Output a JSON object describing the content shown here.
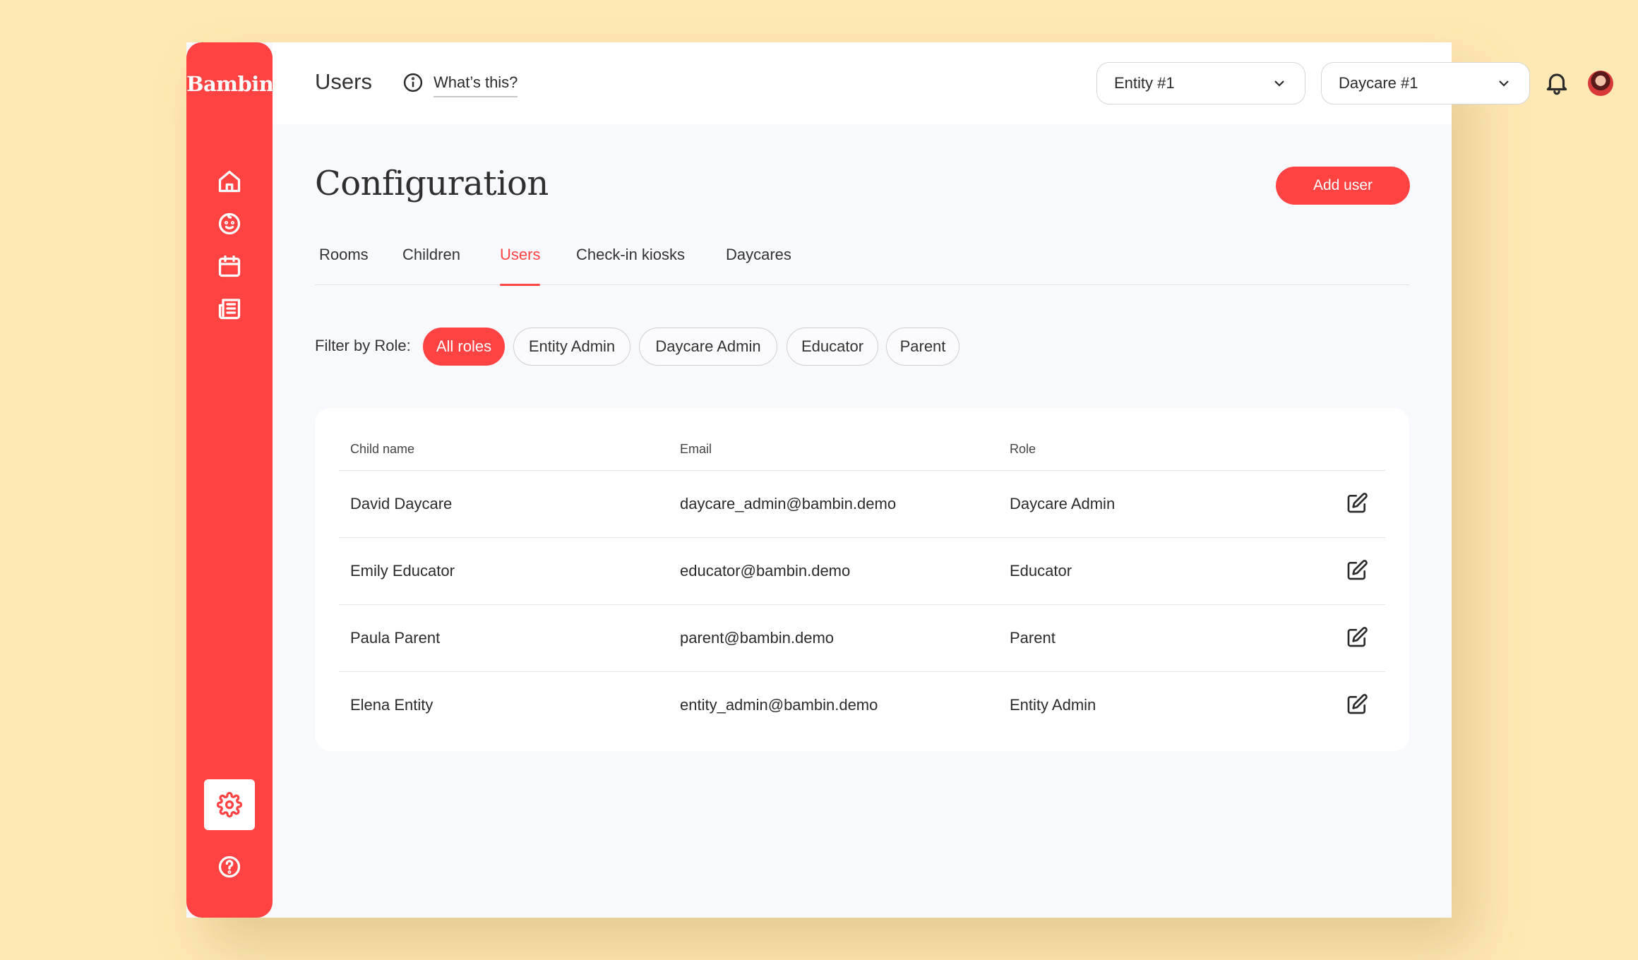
{
  "app": {
    "logo": "Bambin",
    "brand_color": "#ff4343"
  },
  "sidebar": {
    "items": [
      {
        "name": "home",
        "icon": "home-icon"
      },
      {
        "name": "children",
        "icon": "baby-face-icon"
      },
      {
        "name": "calendar",
        "icon": "calendar-icon"
      },
      {
        "name": "newsletter",
        "icon": "newspaper-icon"
      },
      {
        "name": "settings",
        "icon": "gear-icon",
        "active": true
      },
      {
        "name": "help",
        "icon": "help-circle-icon"
      }
    ]
  },
  "header": {
    "title": "Users",
    "whats_this": "What’s this?",
    "entity_select": "Entity #1",
    "daycare_select": "Daycare #1"
  },
  "page": {
    "title": "Configuration",
    "add_button": "Add user"
  },
  "tabs": [
    {
      "label": "Rooms",
      "active": false
    },
    {
      "label": "Children",
      "active": false
    },
    {
      "label": "Users",
      "active": true
    },
    {
      "label": "Check-in kiosks",
      "active": false
    },
    {
      "label": "Daycares",
      "active": false
    }
  ],
  "filter": {
    "label": "Filter by Role:",
    "chips": [
      {
        "label": "All roles",
        "active": true
      },
      {
        "label": "Entity Admin",
        "active": false
      },
      {
        "label": "Daycare Admin",
        "active": false
      },
      {
        "label": "Educator",
        "active": false
      },
      {
        "label": "Parent",
        "active": false
      }
    ]
  },
  "table": {
    "columns": [
      "Child name",
      "Email",
      "Role"
    ],
    "rows": [
      {
        "name": "David Daycare",
        "email": "daycare_admin@bambin.demo",
        "role": "Daycare Admin"
      },
      {
        "name": "Emily Educator",
        "email": "educator@bambin.demo",
        "role": "Educator"
      },
      {
        "name": "Paula Parent",
        "email": "parent@bambin.demo",
        "role": "Parent"
      },
      {
        "name": "Elena Entity",
        "email": "entity_admin@bambin.demo",
        "role": "Entity Admin"
      }
    ]
  }
}
